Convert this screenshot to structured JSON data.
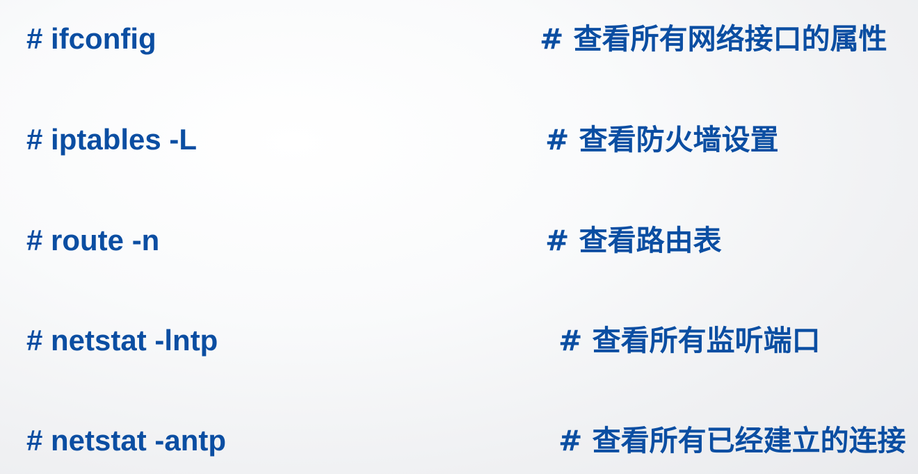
{
  "commands": [
    {
      "command": "# ifconfig",
      "comment": "# 查看所有网络接口的属性"
    },
    {
      "command": "# iptables -L",
      "comment": "# 查看防火墙设置"
    },
    {
      "command": "# route -n",
      "comment": "# 查看路由表"
    },
    {
      "command": "# netstat -lntp",
      "comment": "# 查看所有监听端口"
    },
    {
      "command": "# netstat -antp",
      "comment": "# 查看所有已经建立的连接"
    }
  ]
}
